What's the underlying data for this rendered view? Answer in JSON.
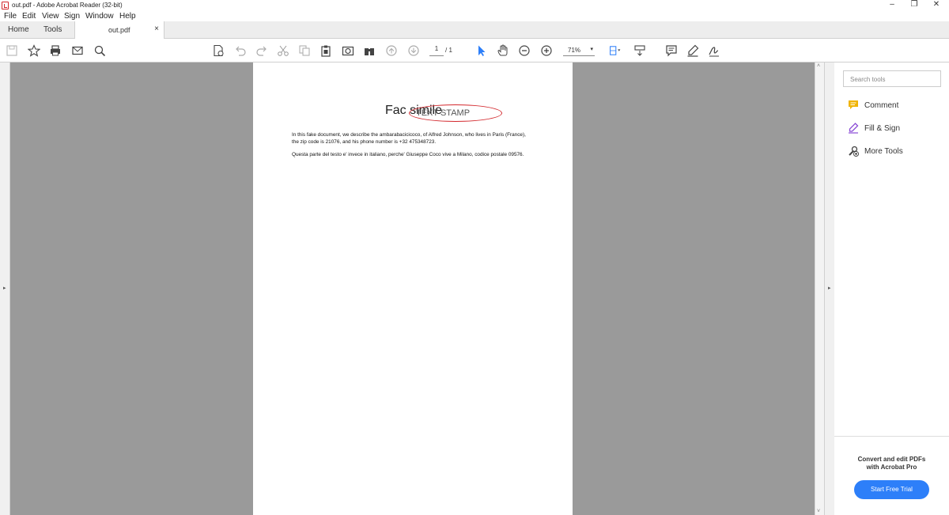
{
  "window": {
    "title": "out.pdf - Adobe Acrobat Reader (32-bit)",
    "controls": {
      "minimize": "–",
      "restore": "❐",
      "close": "✕"
    }
  },
  "menu": [
    "File",
    "Edit",
    "View",
    "Sign",
    "Window",
    "Help"
  ],
  "tabs": {
    "home": "Home",
    "tools": "Tools",
    "document": "out.pdf",
    "close": "×"
  },
  "toolbar": {
    "page_current": "1",
    "page_total": "/ 1",
    "zoom": "71%",
    "zoom_arrow": "▾",
    "icons": [
      "save-icon",
      "bookmark-star-icon",
      "print-icon",
      "email-icon",
      "search-icon",
      "create-pdf-icon",
      "undo-icon",
      "redo-icon",
      "cut-icon",
      "copy-icon",
      "paste-icon",
      "snapshot-icon",
      "binoculars-icon",
      "page-up-icon",
      "page-down-icon",
      "select-arrow-icon",
      "hand-icon",
      "zoom-out-icon",
      "zoom-in-icon",
      "fit-page-icon",
      "scrolling-mode-icon",
      "comment-icon",
      "highlight-pen-icon",
      "sign-icon"
    ],
    "accent": "#2d7ff9"
  },
  "document": {
    "heading": "Fac simile",
    "stamp_text": "TEXT STAMP",
    "stamp_color": "#d3282d",
    "paragraphs": [
      "In this fake document, we describe the ambarabacicicoco, of Alfred Johnson, who lives in Paris (France), the zip code is 21076, and his phone number is +32 475348723.",
      "Questa parte del testo e' invece in italiano, perche' Giuseppe Coco vive a Milano, codice postale 09576."
    ]
  },
  "right_panel": {
    "search_placeholder": "Search tools",
    "tools": [
      {
        "label": "Comment",
        "icon": "comment-icon",
        "color": "#f0b400"
      },
      {
        "label": "Fill & Sign",
        "icon": "fill-sign-icon",
        "color": "#8a4bd6"
      },
      {
        "label": "More Tools",
        "icon": "more-tools-icon",
        "color": "#444444"
      }
    ],
    "promo_line1": "Convert and edit PDFs",
    "promo_line2": "with Acrobat Pro",
    "promo_button": "Start Free Trial"
  },
  "scroll": {
    "left_arrow": "▸",
    "right_arrow": "▸",
    "up": "˄",
    "down": "˅"
  }
}
